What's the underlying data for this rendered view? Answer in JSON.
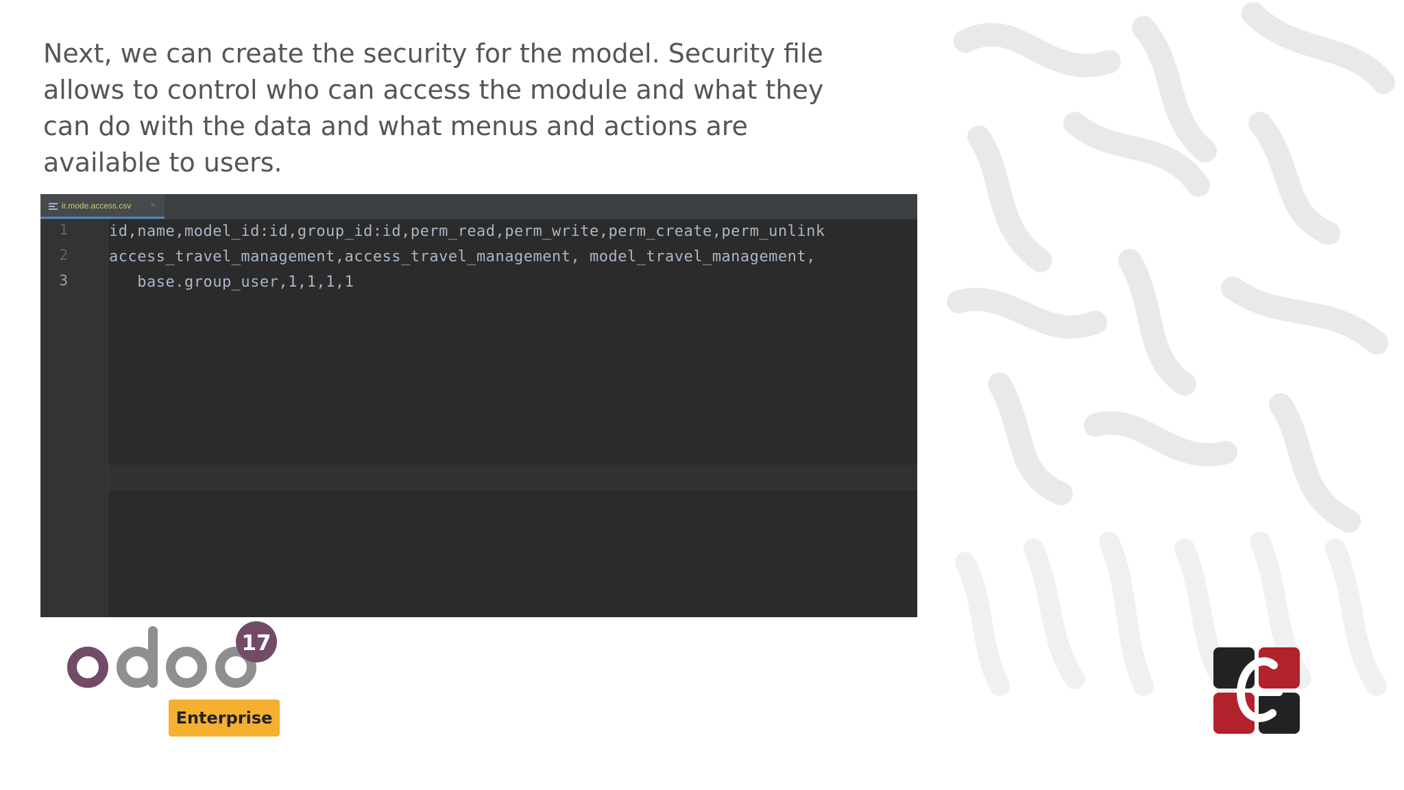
{
  "slide": {
    "intro_text": "Next, we can create the security for the model. Security file allows to control who can access the module and what they can do with the data and what menus and actions are available to users."
  },
  "editor": {
    "tab_label": "ir.mode.access.csv",
    "tab_close": "×",
    "line_numbers": [
      "1",
      "2",
      "3"
    ],
    "lines": [
      "id,name,model_id:id,group_id:id,perm_read,perm_write,perm_create,perm_unlink",
      "access_travel_management,access_travel_management, model_travel_management,",
      "   base.group_user,1,1,1,1"
    ]
  },
  "branding": {
    "product_logo": "odoo",
    "version_badge": "17",
    "edition_label": "Enterprise",
    "corp_logo_icon": "cybrosys-logo-icon"
  },
  "colors": {
    "odoo_purple": "#714b67",
    "odoo_gray": "#8f8f8f",
    "badge_yellow": "#f5b030",
    "corp_red": "#b3212b",
    "corp_dark": "#222222",
    "editor_bg": "#2b2b2b"
  }
}
